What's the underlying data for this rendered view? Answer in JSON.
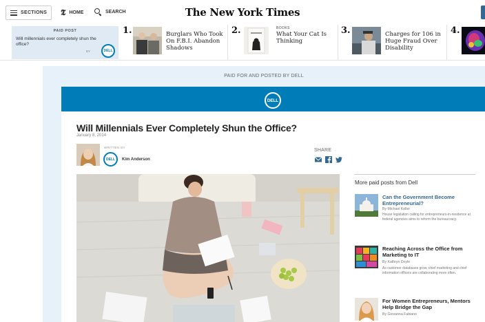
{
  "nav": {
    "sections_label": "SECTIONS",
    "home_label": "HOME",
    "search_label": "SEARCH",
    "masthead": "The New York Times"
  },
  "strip": {
    "paid_label": "PAID POST",
    "paid_text": "Will millennials ever completely shun the office?",
    "paid_by": "BY",
    "paid_brand": "DELL",
    "stories": [
      {
        "num": "1.",
        "kicker": "",
        "headline": "Burglars Who Took On F.B.I. Abandon Shadows"
      },
      {
        "num": "2.",
        "kicker": "BOOKS",
        "headline": "What Your Cat Is Thinking"
      },
      {
        "num": "3.",
        "kicker": "",
        "headline": "Charges for 106 in Huge Fraud Over Disability"
      },
      {
        "num": "4.",
        "kicker": "",
        "headline": ""
      }
    ]
  },
  "article": {
    "paid_banner": "PAID FOR AND POSTED BY DELL",
    "brand_logo": "DELL",
    "title": "Will Millennials Ever Completely Shun the Office?",
    "date": "January 8, 2014",
    "written_by": "WRITTEN BY",
    "author_brand": "DELL",
    "author": "Kim Anderson",
    "share_label": "SHARE"
  },
  "sidebar": {
    "title": "More paid posts from Dell",
    "posts": [
      {
        "headline": "Can the Government Become Entrepreneurial?",
        "byline": "By Michael Keller",
        "desc": "House legislation calling for entrepreneurs-in-residence at federal agencies aims to reform the bureaucracy."
      },
      {
        "headline": "Reaching Across the Office from Marketing to IT",
        "byline": "By Kathryn Doyle",
        "desc": "As customer databases grow, chief marketing and chief information officers are collaborating more often."
      },
      {
        "headline": "For Women Entrepreneurs, Mentors Help Bridge the Gap",
        "byline": "By Giovanna Fabiano",
        "desc": ""
      }
    ]
  },
  "colors": {
    "dell_blue": "#007db8",
    "nyt_link_blue": "#326891",
    "paid_bg": "#e7f1f9"
  }
}
